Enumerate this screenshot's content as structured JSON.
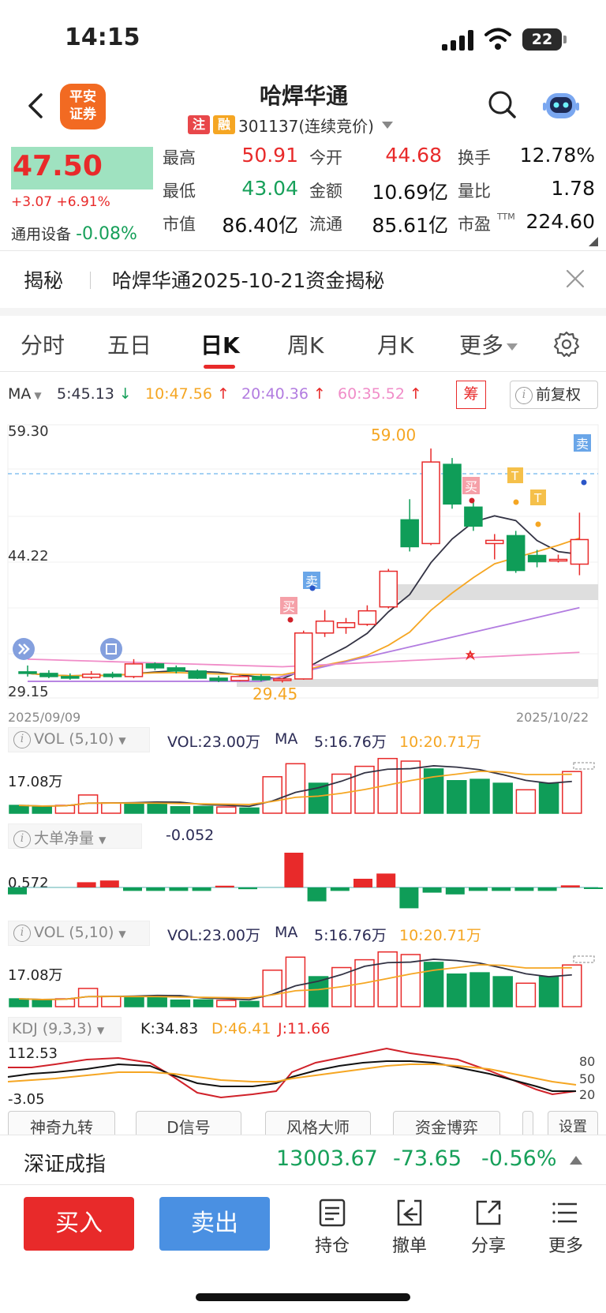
{
  "status": {
    "time": "14:15",
    "battery": "22"
  },
  "header": {
    "logo_line1": "平安",
    "logo_line2": "证券",
    "title": "哈焊华通",
    "tag_zhu": "注",
    "tag_rong": "融",
    "code_text": "301137(连续竞价)"
  },
  "quote": {
    "price": "47.50",
    "change": "+3.07 +6.91%",
    "sector_name": "通用设备",
    "sector_change": "-0.08%",
    "ttm_mark": "TTM",
    "fields": [
      {
        "label": "最高",
        "value": "50.91",
        "color": "red"
      },
      {
        "label": "今开",
        "value": "44.68",
        "color": "red"
      },
      {
        "label": "换手",
        "value": "12.78%",
        "color": "dark"
      },
      {
        "label": "最低",
        "value": "43.04",
        "color": "green"
      },
      {
        "label": "金额",
        "value": "10.69亿",
        "color": "dark"
      },
      {
        "label": "量比",
        "value": "1.78",
        "color": "dark"
      },
      {
        "label": "市值",
        "value": "86.40亿",
        "color": "dark"
      },
      {
        "label": "流通",
        "value": "85.61亿",
        "color": "dark"
      },
      {
        "label": "市盈",
        "value": "224.60",
        "color": "dark"
      }
    ]
  },
  "reveal": {
    "tag": "揭秘",
    "text": "哈焊华通2025-10-21资金揭秘"
  },
  "tabs": [
    "分时",
    "五日",
    "日K",
    "周K",
    "月K",
    "更多"
  ],
  "ma": {
    "label": "MA",
    "ma5": "5:45.13",
    "ma10": "10:47.56",
    "ma20": "20:40.36",
    "ma60": "60:35.52",
    "chou": "筹",
    "fq": "前复权",
    "info_glyph": "i"
  },
  "kline": {
    "y_top": "59.30",
    "y_mid": "44.22",
    "y_bot": "29.15",
    "high_label": "59.00",
    "low_label": "29.45",
    "date_start": "2025/09/09",
    "date_end": "2025/10/22",
    "buy_mark": "买",
    "sell_mark": "卖",
    "t_mark": "T",
    "colors": {
      "up": "#e82a2a",
      "down": "#0f9d58",
      "ma5": "#333344",
      "ma10": "#f5a623",
      "ma20": "#b27ce0",
      "ma60": "#f08cc8"
    },
    "candles": [
      [
        30.8,
        31.6,
        30.2,
        30.6
      ],
      [
        30.6,
        31.0,
        30.0,
        30.2
      ],
      [
        30.2,
        30.6,
        29.8,
        30.1
      ],
      [
        30.1,
        30.9,
        29.9,
        30.5
      ],
      [
        30.5,
        30.8,
        30.0,
        30.2
      ],
      [
        30.2,
        32.4,
        30.0,
        31.8
      ],
      [
        31.8,
        32.0,
        31.0,
        31.3
      ],
      [
        31.3,
        31.6,
        30.6,
        30.9
      ],
      [
        30.9,
        31.1,
        29.9,
        30.0
      ],
      [
        30.0,
        30.3,
        29.5,
        29.7
      ],
      [
        29.7,
        30.4,
        29.6,
        30.2
      ],
      [
        30.2,
        30.5,
        29.6,
        29.8
      ],
      [
        29.8,
        30.0,
        29.45,
        29.9
      ],
      [
        29.9,
        36.0,
        29.8,
        35.7
      ],
      [
        35.7,
        38.6,
        35.2,
        37.2
      ],
      [
        36.4,
        37.6,
        35.6,
        37.0
      ],
      [
        36.8,
        39.2,
        36.6,
        38.5
      ],
      [
        39.0,
        43.8,
        38.8,
        43.5
      ],
      [
        50.0,
        52.6,
        46.0,
        46.6
      ],
      [
        47.0,
        59.0,
        46.8,
        57.3
      ],
      [
        57.0,
        57.8,
        51.4,
        52.0
      ],
      [
        51.6,
        52.4,
        48.6,
        49.2
      ],
      [
        47.0,
        48.2,
        45.0,
        47.4
      ],
      [
        48.0,
        48.6,
        43.3,
        43.6
      ],
      [
        45.5,
        46.2,
        44.0,
        44.7
      ],
      [
        44.8,
        45.6,
        44.6,
        45.0
      ],
      [
        44.4,
        50.9,
        43.0,
        47.5
      ]
    ]
  },
  "vol1": {
    "title": "VOL (5,10)",
    "vol": "VOL:23.00万",
    "ma_label": "MA",
    "ma5": "5:16.76万",
    "ma10": "10:20.71万",
    "axis": "17.08万",
    "values": [
      3,
      2.5,
      3,
      7,
      4,
      3.8,
      3.8,
      2.5,
      2.6,
      2.4,
      2,
      14,
      19,
      11.5,
      15,
      18,
      21,
      20,
      17,
      12.5,
      13,
      11.5,
      9,
      11.5,
      16
    ]
  },
  "netflow": {
    "title": "大单净量",
    "value": "-0.052",
    "axis": "0.572",
    "values": [
      -0.2,
      0,
      0,
      0.15,
      0.2,
      -0.1,
      -0.1,
      -0.1,
      -0.1,
      0.05,
      -0.05,
      0,
      1.0,
      -0.4,
      -0.1,
      0.25,
      0.4,
      -0.6,
      -0.15,
      -0.2,
      -0.1,
      -0.1,
      -0.1,
      -0.1,
      0.06,
      -0.02
    ]
  },
  "vol2": {
    "title": "VOL (5,10)",
    "vol": "VOL:23.00万",
    "ma_label": "MA",
    "ma5": "5:16.76万",
    "ma10": "10:20.71万",
    "axis": "17.08万"
  },
  "kdj": {
    "title": "KDJ (9,3,3)",
    "k": "K:34.83",
    "d": "D:46.41",
    "j": "J:11.66",
    "y_top": "112.53",
    "y_bot": "-3.05",
    "ref80": "80",
    "ref50": "50",
    "ref20": "20"
  },
  "tools": [
    "神奇九转",
    "D信号",
    "风格大师",
    "资金博弈",
    "设置"
  ],
  "index": {
    "name": "深证成指",
    "value": "13003.67",
    "change": "-73.65",
    "pct": "-0.56%"
  },
  "bottom": {
    "buy": "买入",
    "sell": "卖出",
    "items": [
      "持仓",
      "撤单",
      "分享",
      "更多"
    ]
  }
}
